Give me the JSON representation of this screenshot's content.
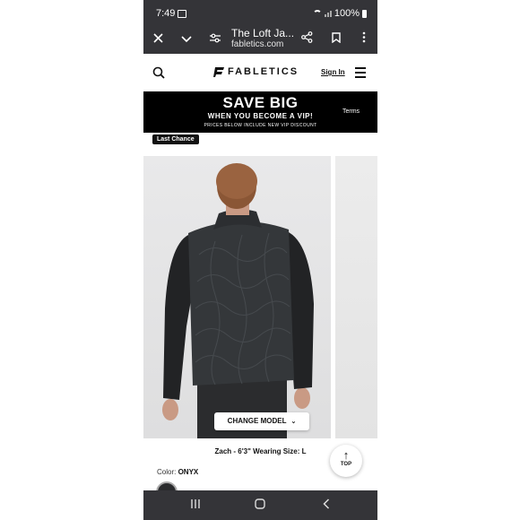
{
  "status": {
    "time": "7:49",
    "battery": "100%"
  },
  "browser": {
    "title": "The Loft Ja...",
    "domain": "fabletics.com"
  },
  "site": {
    "brand": "FABLETICS",
    "sign_in": "Sign In"
  },
  "banner": {
    "headline": "SAVE BIG",
    "subline": "WHEN YOU BECOME A VIP!",
    "fineprint": "PRICES BELOW INCLUDE NEW VIP DISCOUNT",
    "terms": "Terms"
  },
  "product": {
    "badge": "Last Chance",
    "change_model": "CHANGE MODEL",
    "model_caption": "Zach - 6'3\" Wearing Size: L",
    "color_label": "Color:",
    "color_value": "ONYX",
    "top_label": "TOP"
  },
  "colors": {
    "chrome": "#343438",
    "banner": "#000000",
    "jacket": "#2f3133"
  }
}
